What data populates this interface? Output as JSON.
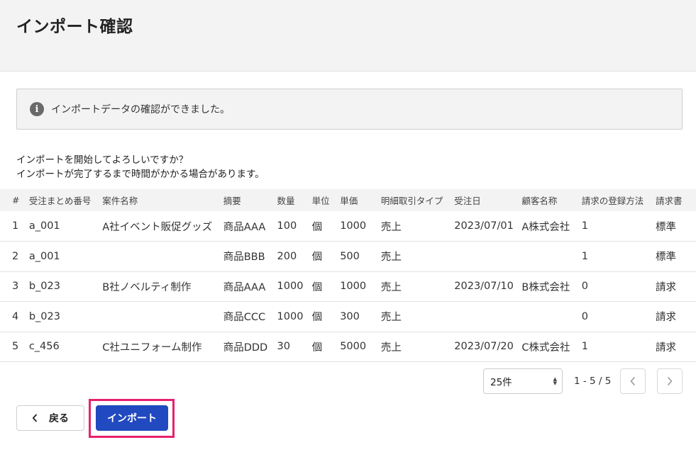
{
  "page": {
    "title": "インポート確認"
  },
  "info": {
    "icon": "info-icon",
    "icon_glyph": "i",
    "message": "インポートデータの確認ができました。"
  },
  "confirm": {
    "line1": "インポートを開始してよろしいですか？",
    "line2": "インポートが完了するまで時間がかかる場合があります。"
  },
  "table": {
    "headers": [
      "#",
      "受注まとめ番号",
      "案件名称",
      "摘要",
      "数量",
      "単位",
      "単価",
      "明細取引タイプ",
      "受注日",
      "顧客名称",
      "請求の登録方法",
      "請求書"
    ],
    "rows": [
      [
        "1",
        "a_001",
        "A社イベント販促グッズ",
        "商品AAA",
        "100",
        "個",
        "1000",
        "売上",
        "2023/07/01",
        "A株式会社",
        "1",
        "標準"
      ],
      [
        "2",
        "a_001",
        "",
        "商品BBB",
        "200",
        "個",
        "500",
        "売上",
        "",
        "",
        "1",
        "標準"
      ],
      [
        "3",
        "b_023",
        "B社ノベルティ制作",
        "商品AAA",
        "1000",
        "個",
        "1000",
        "売上",
        "2023/07/10",
        "B株式会社",
        "0",
        "請求"
      ],
      [
        "4",
        "b_023",
        "",
        "商品CCC",
        "1000",
        "個",
        "300",
        "売上",
        "",
        "",
        "0",
        "請求"
      ],
      [
        "5",
        "c_456",
        "C社ユニフォーム制作",
        "商品DDD",
        "30",
        "個",
        "5000",
        "売上",
        "2023/07/20",
        "C株式会社",
        "1",
        "請求"
      ]
    ]
  },
  "pagination": {
    "per_page": "25件",
    "range": "1 - 5 / 5",
    "prev_icon": "chevron-left-icon",
    "next_icon": "chevron-right-icon"
  },
  "actions": {
    "back_label": "戻る",
    "import_label": "インポート"
  },
  "colors": {
    "primary": "#2149c0",
    "highlight": "#e8216f",
    "header_bg": "#f3f3f3"
  }
}
